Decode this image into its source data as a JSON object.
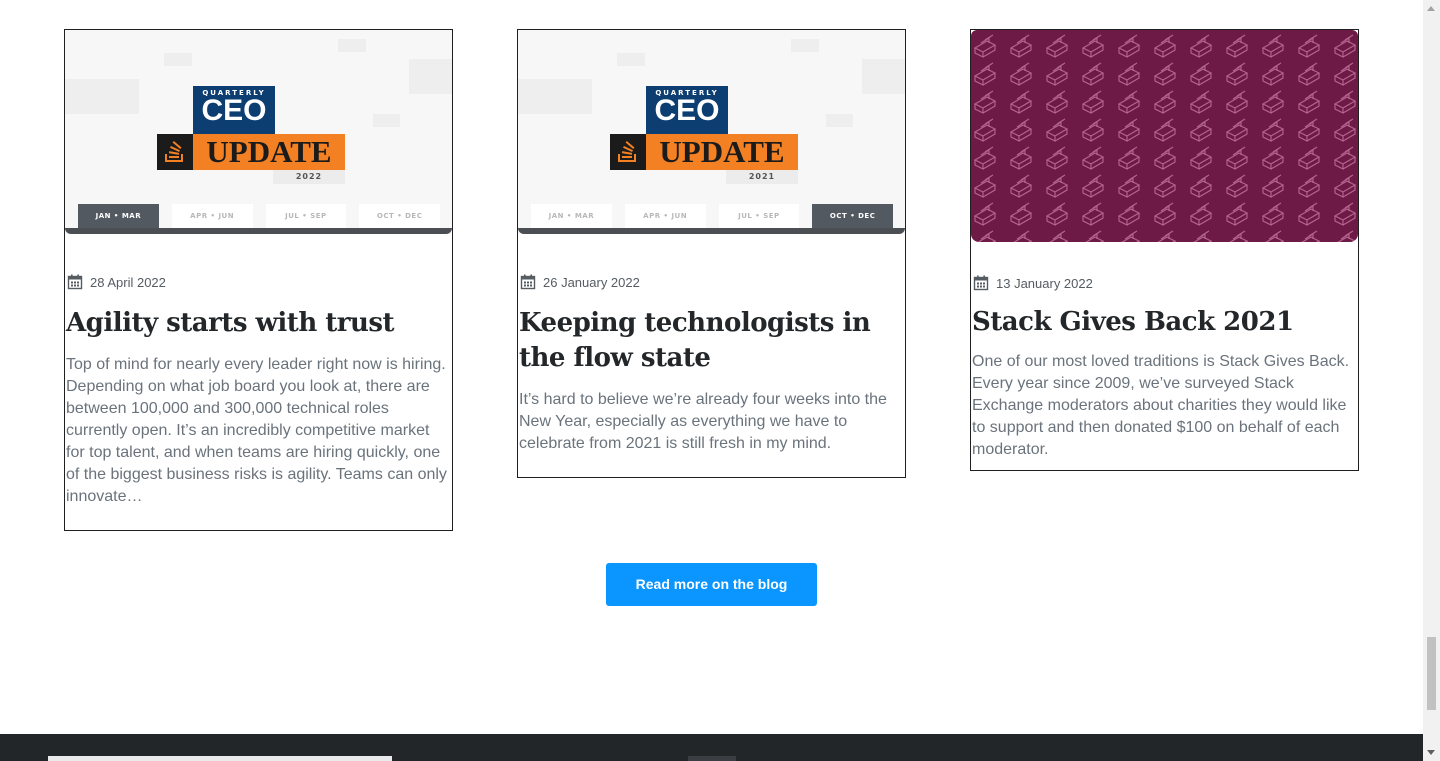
{
  "posts": [
    {
      "date": "28 April 2022",
      "title": "Agility starts with trust",
      "excerpt": "Top of mind for nearly every leader right now is hiring. Depending on what job board you look at, there are between 100,000 and 300,000 technical roles currently open. It’s an incredibly competitive market for top talent, and when teams are hiring quickly, one of the biggest business risks is agility. Teams can only innovate…",
      "image": {
        "quarterly": "QUARTERLY",
        "ceo": "CEO",
        "update": "UPDATE",
        "year": "2022",
        "tabs": [
          "JAN • MAR",
          "APR • JUN",
          "JUL • SEP",
          "OCT • DEC"
        ],
        "active_tab": 0
      }
    },
    {
      "date": "26 January 2022",
      "title": "Keeping technologists in the flow state",
      "excerpt": "It’s hard to believe we’re already four weeks into the New Year, especially as everything we have to celebrate from 2021 is still fresh in my mind.",
      "image": {
        "quarterly": "QUARTERLY",
        "ceo": "CEO",
        "update": "UPDATE",
        "year": "2021",
        "tabs": [
          "JAN • MAR",
          "APR • JUN",
          "JUL • SEP",
          "OCT • DEC"
        ],
        "active_tab": 3
      }
    },
    {
      "date": "13 January 2022",
      "title": "Stack Gives Back 2021",
      "excerpt": "One of our most loved traditions is Stack Gives Back. Every year since 2009, we’ve surveyed Stack Exchange moderators about charities they would like to support and then donated $100 on behalf of each moderator.",
      "image": {
        "pattern_color": "#6d1b46"
      }
    }
  ],
  "read_more_label": "Read more on the blog",
  "colors": {
    "accent": "#0a95ff",
    "orange": "#f48024",
    "navy": "#0d3e72",
    "footer": "#232629"
  },
  "icons": {
    "date": "calendar-icon",
    "logo": "stack-overflow-logo-icon"
  }
}
